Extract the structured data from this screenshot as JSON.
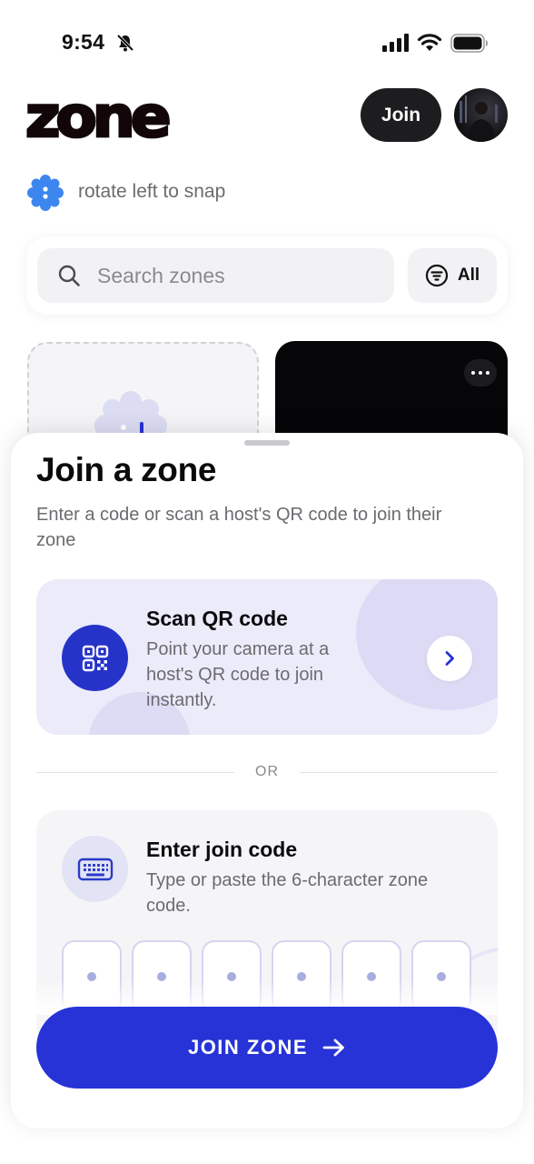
{
  "status_bar": {
    "time": "9:54"
  },
  "header": {
    "logo": "zone",
    "join_label": "Join"
  },
  "hint": {
    "text": "rotate left to snap"
  },
  "search": {
    "placeholder": "Search zones",
    "filter_label": "All"
  },
  "sheet": {
    "title": "Join a zone",
    "subtitle": "Enter a code or scan a host's QR code to join their zone",
    "scan": {
      "title": "Scan QR code",
      "description": "Point your camera at a host's QR code to join instantly."
    },
    "divider_text": "OR",
    "code": {
      "title": "Enter join code",
      "description": "Type or paste the 6-character zone code.",
      "slots": [
        "",
        "",
        "",
        "",
        "",
        ""
      ]
    },
    "join_button_label": "JOIN ZONE"
  },
  "colors": {
    "accent": "#2733d6",
    "scan_icon_bg": "#2633c9",
    "scan_card_bg": "#ecebfa"
  },
  "icons": [
    "bell-slash-icon",
    "signal-icon",
    "wifi-icon",
    "battery-icon",
    "snap-mascot-icon",
    "search-icon",
    "filter-icon",
    "more-icon",
    "qr-code-icon",
    "chevron-right-icon",
    "keyboard-icon",
    "arrow-right-icon"
  ]
}
